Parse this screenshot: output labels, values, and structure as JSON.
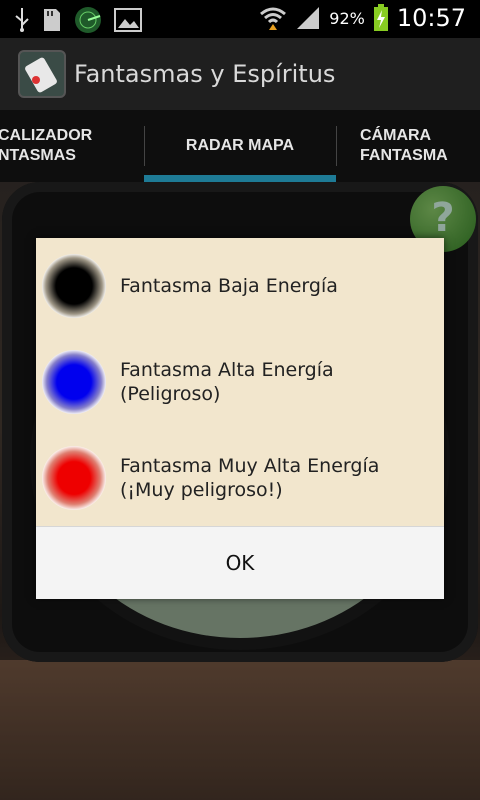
{
  "status": {
    "battery_percent": "92%",
    "time": "10:57",
    "icons": [
      "usb-icon",
      "sd-card-icon",
      "radar-notification-icon",
      "image-icon",
      "wifi-icon",
      "signal-icon",
      "battery-charging-icon"
    ]
  },
  "app": {
    "title": "Fantasmas y Espíritus"
  },
  "tabs": [
    {
      "label_line1": "CALIZADOR",
      "label_line2": "NTASMAS"
    },
    {
      "label": "RADAR MAPA"
    },
    {
      "label_line1": "CÁMARA",
      "label_line2": "FANTASMA"
    }
  ],
  "dialog": {
    "items": [
      {
        "color": "#000000",
        "line1": "Fantasma Baja Energía",
        "line2": ""
      },
      {
        "color": "#0000ee",
        "line1": "Fantasma Alta Energía",
        "line2": "(Peligroso)"
      },
      {
        "color": "#ee0000",
        "line1": "Fantasma Muy Alta Energía",
        "line2": "(¡Muy peligroso!)"
      }
    ],
    "ok_label": "OK"
  },
  "help_symbol": "?"
}
